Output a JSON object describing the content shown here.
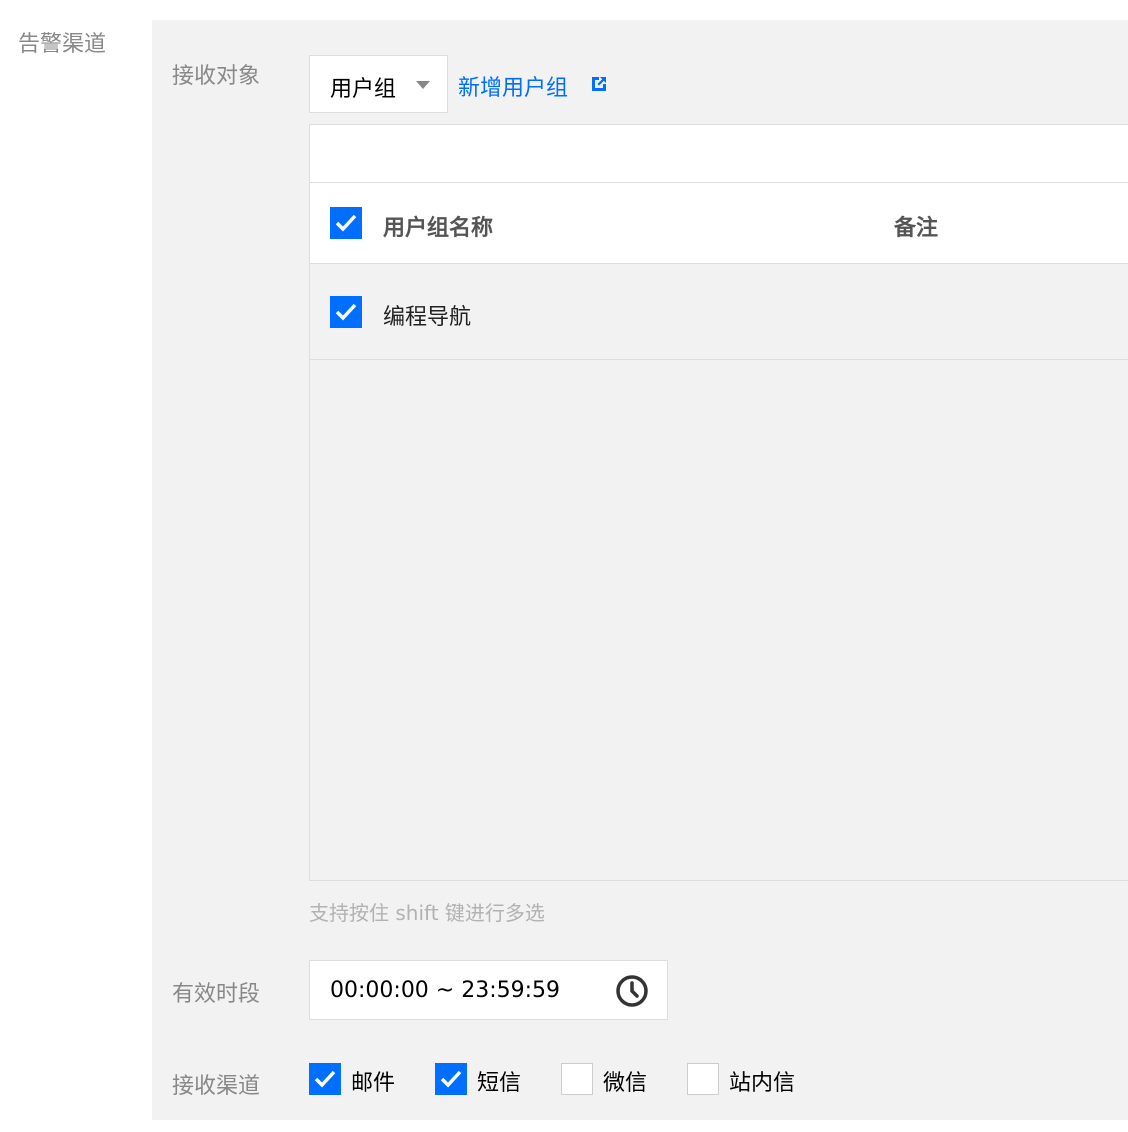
{
  "section": {
    "label": "告警渠道"
  },
  "receiver": {
    "label": "接收对象",
    "select_value": "用户组",
    "add_link": "新增用户组",
    "table": {
      "search_value": "",
      "header_checked": true,
      "columns": [
        "用户组名称",
        "备注"
      ],
      "rows": [
        {
          "checked": true,
          "name": "编程导航",
          "note": ""
        }
      ]
    },
    "hint": "支持按住 shift 键进行多选"
  },
  "period": {
    "label": "有效时段",
    "value": "00:00:00 ~ 23:59:59"
  },
  "channels": {
    "label": "接收渠道",
    "options": [
      {
        "label": "邮件",
        "checked": true
      },
      {
        "label": "短信",
        "checked": true
      },
      {
        "label": "微信",
        "checked": false
      },
      {
        "label": "站内信",
        "checked": false
      }
    ]
  },
  "colors": {
    "accent": "#006eff",
    "panel_bg": "#f2f2f2",
    "label": "#888888",
    "border": "#dddddd"
  },
  "icons": {
    "dropdown": "caret-down-icon",
    "external": "external-link-icon",
    "time": "clock-icon",
    "check": "checkmark-icon"
  }
}
